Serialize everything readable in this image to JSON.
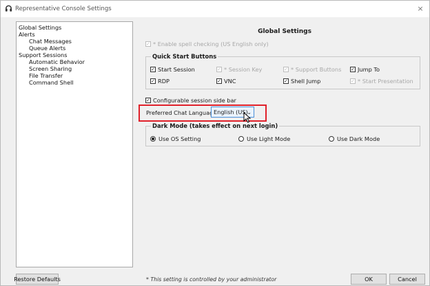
{
  "window": {
    "title": "Representative Console Settings",
    "close_glyph": "×",
    "app_icon": "headset-icon"
  },
  "nav": {
    "items": [
      {
        "label": "Global Settings"
      },
      {
        "label": "Alerts"
      },
      {
        "label": "Chat Messages"
      },
      {
        "label": "Queue Alerts"
      },
      {
        "label": "Support Sessions"
      },
      {
        "label": "Automatic Behavior"
      },
      {
        "label": "Screen Sharing"
      },
      {
        "label": "File Transfer"
      },
      {
        "label": "Command Shell"
      }
    ]
  },
  "main": {
    "title": "Global Settings",
    "spell_check": {
      "label": "* Enable spell checking (US English only)",
      "checked": true,
      "disabled": true
    },
    "quick_start": {
      "legend": "Quick Start Buttons",
      "items": [
        {
          "label": "Start Session",
          "checked": true,
          "disabled": false
        },
        {
          "label": "* Session Key",
          "checked": true,
          "disabled": true
        },
        {
          "label": "* Support Buttons",
          "checked": true,
          "disabled": true
        },
        {
          "label": "Jump To",
          "checked": true,
          "disabled": false
        },
        {
          "label": "RDP",
          "checked": true,
          "disabled": false
        },
        {
          "label": "VNC",
          "checked": true,
          "disabled": false
        },
        {
          "label": "Shell Jump",
          "checked": true,
          "disabled": false
        },
        {
          "label": "* Start Presentation",
          "checked": true,
          "disabled": true
        }
      ]
    },
    "side_bar": {
      "label": "Configurable session side bar",
      "checked": true
    },
    "chat_language": {
      "label": "Preferred Chat Language:",
      "value": "English (US)"
    },
    "dark_mode": {
      "legend": "Dark Mode (takes effect on next login)",
      "options": [
        {
          "label": "Use OS Setting",
          "selected": true
        },
        {
          "label": "Use Light Mode",
          "selected": false
        },
        {
          "label": "Use Dark Mode",
          "selected": false
        }
      ]
    }
  },
  "footer": {
    "restore_label": "Restore Defaults",
    "note": "* This setting is controlled by your administrator",
    "ok_label": "OK",
    "cancel_label": "Cancel"
  },
  "colors": {
    "highlight": "#e0202a",
    "select_border": "#4a90d9",
    "window_bg": "#f0f0f0"
  },
  "check_glyph": "✓"
}
